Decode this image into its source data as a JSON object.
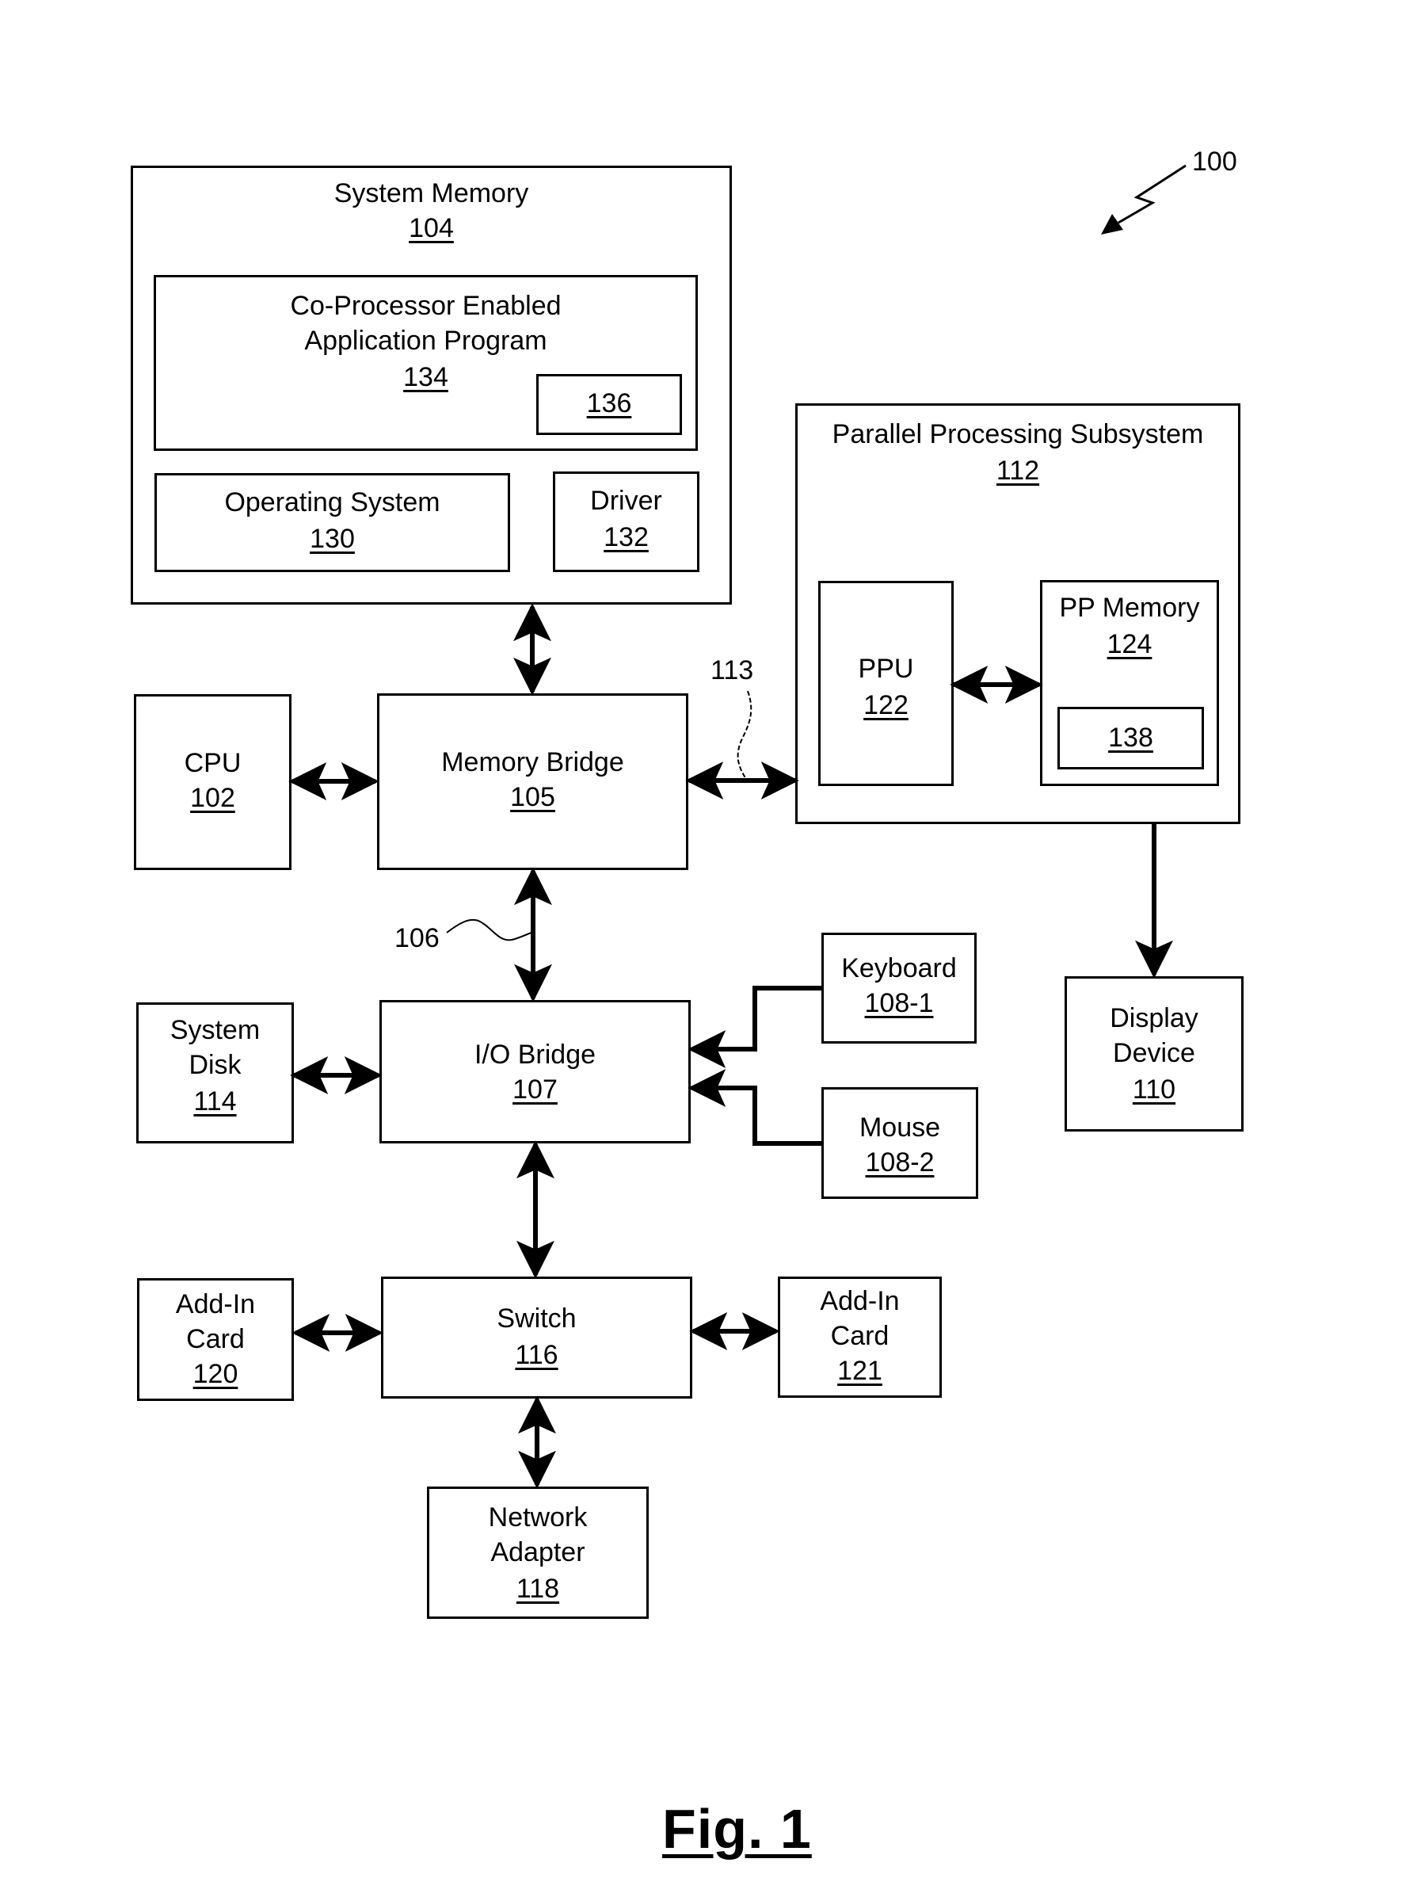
{
  "figure": {
    "caption": "Fig. 1",
    "system_ref": "100"
  },
  "blocks": {
    "system_memory": {
      "name": "System Memory",
      "ref": "104"
    },
    "coproc_app": {
      "name_line1": "Co-Processor Enabled",
      "name_line2": "Application Program",
      "ref": "134"
    },
    "box_136": {
      "ref": "136"
    },
    "operating_system": {
      "name": "Operating System",
      "ref": "130"
    },
    "driver": {
      "name": "Driver",
      "ref": "132"
    },
    "parallel_processing_subsystem": {
      "name": "Parallel Processing Subsystem",
      "ref": "112"
    },
    "ppu": {
      "name": "PPU",
      "ref": "122"
    },
    "pp_memory": {
      "name": "PP Memory",
      "ref": "124"
    },
    "box_138": {
      "ref": "138"
    },
    "cpu": {
      "name": "CPU",
      "ref": "102"
    },
    "memory_bridge": {
      "name": "Memory Bridge",
      "ref": "105"
    },
    "system_disk": {
      "name_line1": "System",
      "name_line2": "Disk",
      "ref": "114"
    },
    "io_bridge": {
      "name": "I/O Bridge",
      "ref": "107"
    },
    "keyboard": {
      "name": "Keyboard",
      "ref": "108-1"
    },
    "mouse": {
      "name": "Mouse",
      "ref": "108-2"
    },
    "display_device": {
      "name_line1": "Display",
      "name_line2": "Device",
      "ref": "110"
    },
    "add_in_card_120": {
      "name_line1": "Add-In",
      "name_line2": "Card",
      "ref": "120"
    },
    "switch": {
      "name": "Switch",
      "ref": "116"
    },
    "add_in_card_121": {
      "name_line1": "Add-In",
      "name_line2": "Card",
      "ref": "121"
    },
    "network_adapter": {
      "name_line1": "Network",
      "name_line2": "Adapter",
      "ref": "118"
    }
  },
  "connections": {
    "communication_path_113": "113",
    "communication_path_106": "106"
  }
}
